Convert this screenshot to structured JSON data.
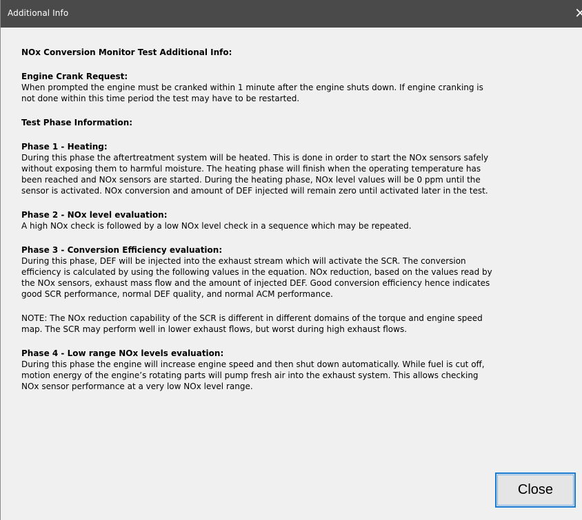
{
  "window": {
    "title": "Additional Info",
    "close_glyph": "×"
  },
  "content": {
    "heading": "NOx Conversion Monitor Test Additional Info:",
    "engine_crank": {
      "title": "Engine Crank Request:",
      "lines": [
        "When prompted the engine must be cranked within 1 minute after the engine shuts down. If engine cranking is",
        "not done within this time period the test may have to be restarted."
      ]
    },
    "test_phase_heading": "Test Phase Information:",
    "phase1": {
      "title": "Phase 1 - Heating:",
      "lines": [
        "During this phase the aftertreatment system will be heated. This is done in order to start the NOx sensors safely",
        "without exposing them to harmful moisture. The heating phase will finish when the operating temperature has",
        "been reached and NOx sensors are started. During the heating phase, NOx level values will be 0 ppm until the",
        "sensor is activated. NOx conversion and amount of DEF injected will remain zero until activated later in the test."
      ]
    },
    "phase2": {
      "title": "Phase 2 - NOx level evaluation:",
      "lines": [
        "A high NOx check is followed by a low NOx level check in a sequence which may be repeated."
      ]
    },
    "phase3": {
      "title": "Phase 3 - Conversion Efficiency evaluation:",
      "lines": [
        "During this phase, DEF will be injected into the exhaust stream which will activate the SCR. The conversion",
        "efficiency is calculated by using the following values in the equation. NOx reduction, based on the values read by",
        "the NOx sensors, exhaust mass flow and the amount of injected DEF. Good conversion efficiency hence indicates",
        "good SCR performance, normal DEF quality, and normal ACM performance."
      ]
    },
    "note": {
      "lines": [
        "NOTE: The NOx reduction capability of the SCR is different in different domains of the torque and engine speed",
        "map. The SCR may perform well in lower exhaust flows, but worst during high exhaust flows."
      ]
    },
    "phase4": {
      "title": "Phase 4 - Low range NOx levels evaluation:",
      "lines": [
        "During this phase the engine will increase engine speed and then shut down automatically. While fuel is cut off,",
        "motion energy of the engine’s rotating parts will pump fresh air into the exhaust system. This allows checking",
        "NOx sensor performance at a very low NOx level range."
      ]
    }
  },
  "buttons": {
    "close_label": "Close"
  },
  "colors": {
    "titlebar": "#4a4a4a",
    "background": "#f0f0f0",
    "button_focus_border": "#1a7bd3"
  }
}
